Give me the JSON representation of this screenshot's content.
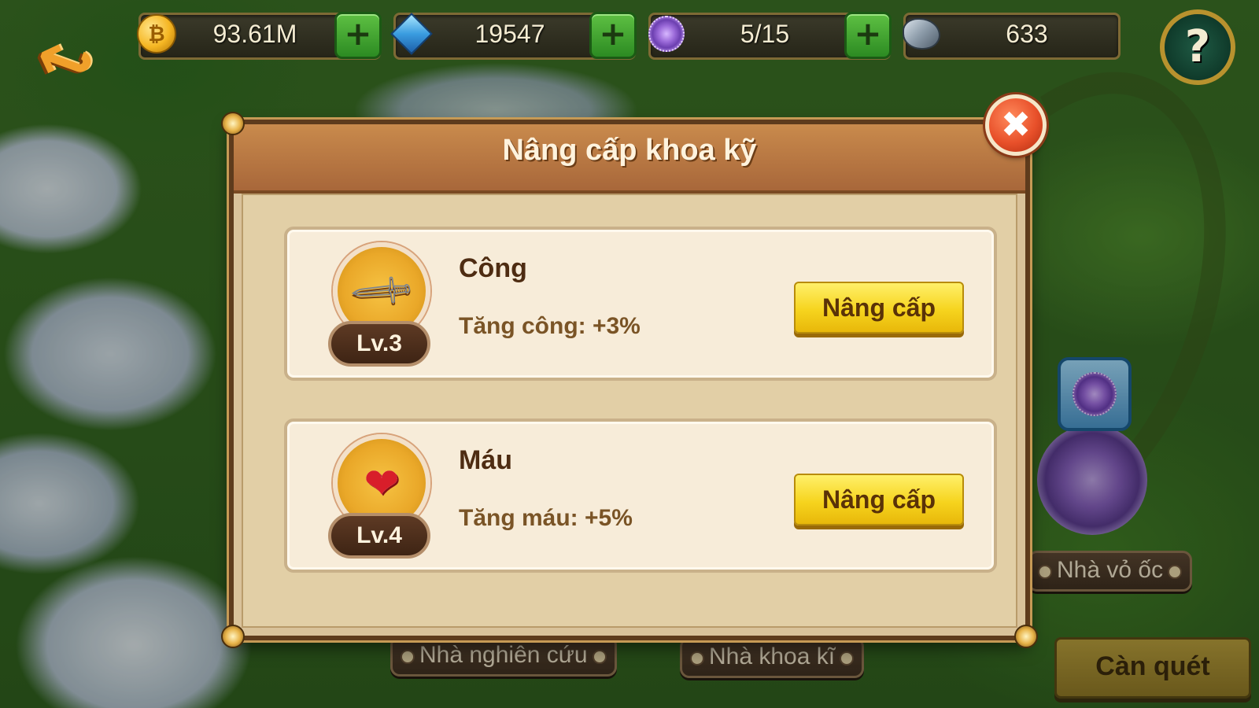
{
  "resources": {
    "gold": {
      "value": "93.61M",
      "icon": "gold-coin-icon"
    },
    "gems": {
      "value": "19547",
      "icon": "gem-icon"
    },
    "energy": {
      "value": "5/15",
      "icon": "purple-swirl-icon"
    },
    "ore": {
      "value": "633",
      "icon": "ore-stone-icon"
    }
  },
  "buttons": {
    "help": "?",
    "close": "✖",
    "scan": "Càn quét"
  },
  "map_labels": {
    "research": "Nhà nghiên cứu",
    "tech": "Nhà khoa kĩ",
    "shell": "Nhà vỏ ốc"
  },
  "dialog": {
    "title": "Nâng cấp khoa kỹ",
    "techs": [
      {
        "name": "Công",
        "level": "Lv.3",
        "effect": "Tăng công: +3%",
        "button": "Nâng cấp",
        "icon": "sword-icon"
      },
      {
        "name": "Máu",
        "level": "Lv.4",
        "effect": "Tăng máu: +5%",
        "button": "Nâng cấp",
        "icon": "heart-icon"
      }
    ]
  },
  "colors": {
    "upgrade_button": "#f6d41e",
    "plus_button": "#2c8b22",
    "close_button": "#e8502a",
    "dialog_header": "#a8673a"
  }
}
